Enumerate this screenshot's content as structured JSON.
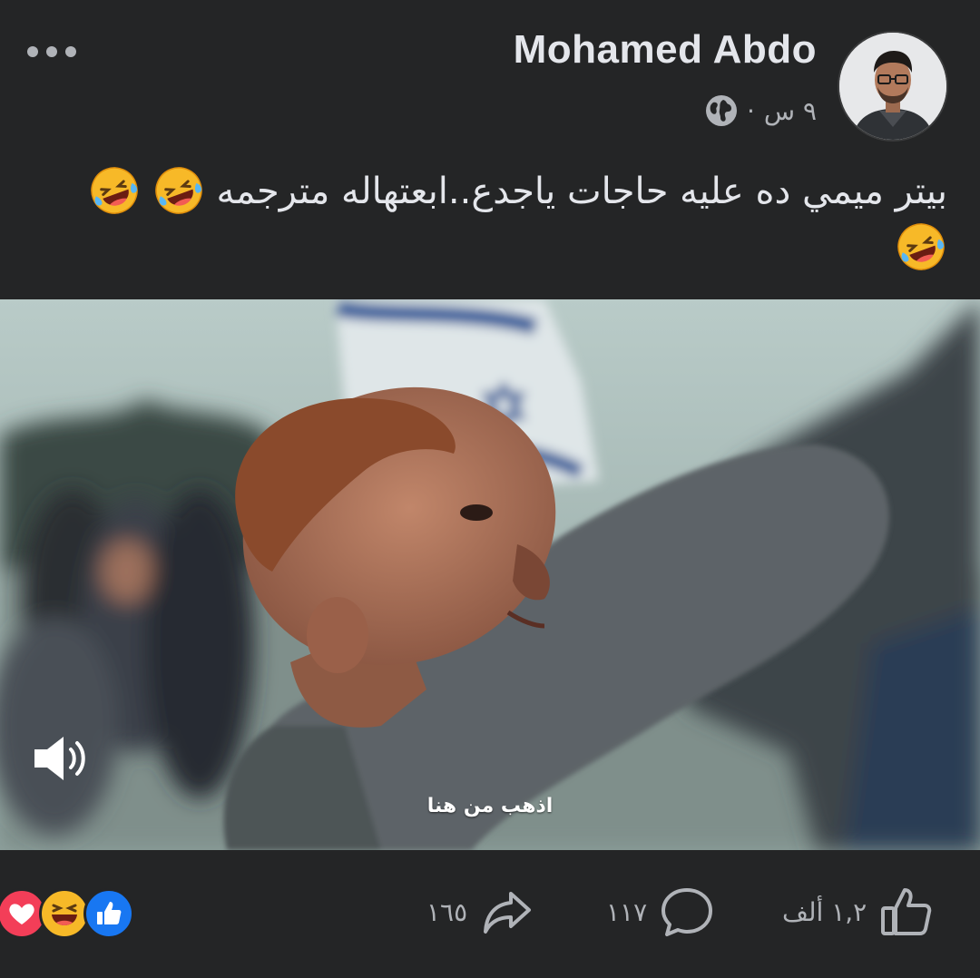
{
  "author": {
    "name": "Mohamed Abdo",
    "time": "٩ س",
    "separator": "·",
    "privacy_icon": "globe-icon"
  },
  "post": {
    "caption": "بيتر ميمي ده عليه حاجات ياجدع..ابعتهاله مترجمه",
    "caption_emoji": [
      "rolling-on-floor-laughing",
      "rolling-on-floor-laughing",
      "rolling-on-floor-laughing"
    ]
  },
  "video": {
    "subtitle": "اذهب من هنا",
    "sound_icon": "speaker-icon"
  },
  "footer": {
    "reactions": [
      "love",
      "haha",
      "like"
    ],
    "share_count": "١٦٥",
    "comment_count": "١١٧",
    "like_count": "١,٢ ألف"
  },
  "colors": {
    "background": "#242526",
    "text": "#e4e6eb",
    "secondary_text": "#b0b3b8",
    "like_blue": "#1877f2",
    "love_red": "#f33e58",
    "haha_yellow": "#f7b928"
  }
}
